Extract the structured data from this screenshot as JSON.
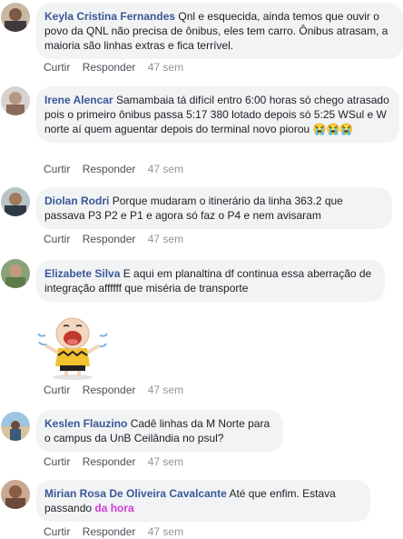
{
  "actions": {
    "like": "Curtir",
    "reply": "Responder"
  },
  "comments": [
    {
      "author": "Keyla Cristina Fernandes",
      "text": "Qnl e esquecida, ainda temos que ouvir o povo da QNL não precisa de ônibus, eles tem carro. Ônibus atrasam, a maioria são linhas extras e fica terrível.",
      "time": "47 sem"
    },
    {
      "author": "Irene Alencar",
      "text": "Samambaia tá difícil entro 6:00 horas só chego atrasado pois o primeiro ônibus passa 5:17 380 lotado depois só 5:25 WSul e W norte aí quem aguentar depois do terminal novo piorou",
      "emoji": "😭😭😭",
      "time": "47 sem"
    },
    {
      "author": "Diolan Rodri",
      "text": "Porque mudaram o itinerário da linha 363.2 que passava P3 P2 e P1 e agora só faz o P4 e nem avisaram",
      "time": "47 sem"
    },
    {
      "author": "Elizabete Silva",
      "text": "E aqui em planaltina df continua essa aberração de integração affffff que miséria de transporte",
      "time": "47 sem"
    },
    {
      "author": "Keslen Flauzino",
      "text": "Cadê linhas da M Norte para o campus da UnB Ceilândia no psul?",
      "time": "47 sem"
    },
    {
      "author": "Mirian Rosa De Oliveira Cavalcante",
      "text": "Até que enfim. Estava passando",
      "link": "da hora",
      "time": "47 sem"
    }
  ],
  "colors": {
    "author": "#385898",
    "bubble": "#f2f3f5",
    "link": "#d53ad6",
    "meta": "#90949c"
  }
}
